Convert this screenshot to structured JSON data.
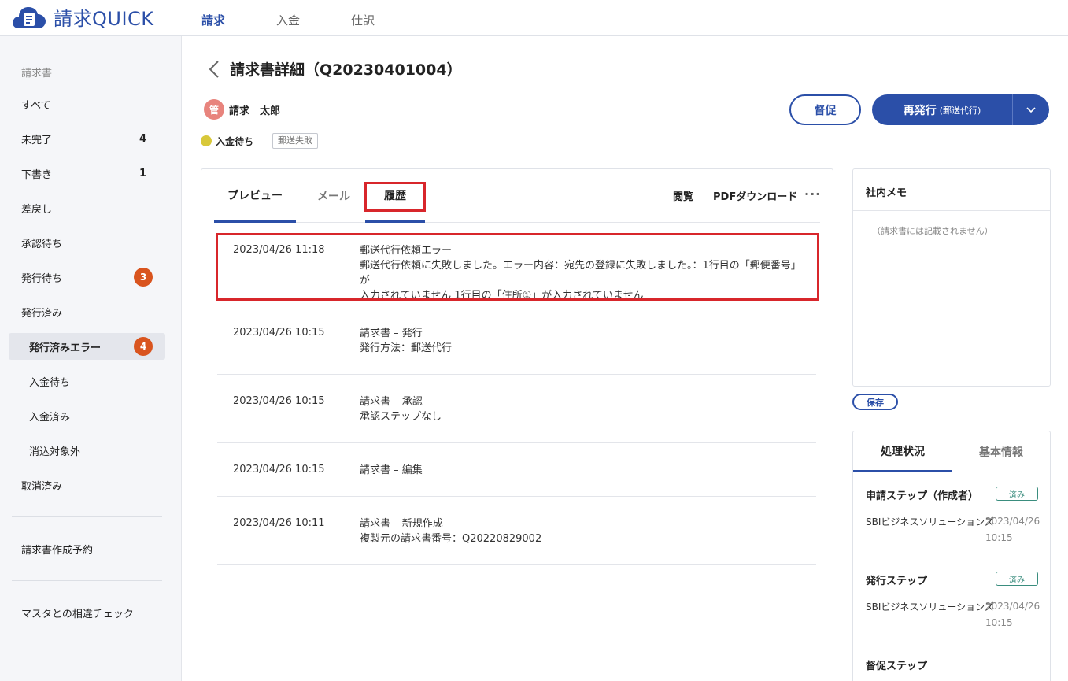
{
  "app": {
    "logo_text": "請求QUICK",
    "nav": [
      "請求",
      "入金",
      "仕訳"
    ]
  },
  "sidebar": {
    "heading": "請求書",
    "items": [
      {
        "label": "すべて"
      },
      {
        "label": "未完了",
        "count": "4"
      },
      {
        "label": "下書き",
        "count": "1"
      },
      {
        "label": "差戻し"
      },
      {
        "label": "承認待ち"
      },
      {
        "label": "発行待ち",
        "badge": "3"
      },
      {
        "label": "発行済み"
      },
      {
        "label": "発行済みエラー",
        "badge": "4"
      },
      {
        "label": "入金待ち"
      },
      {
        "label": "入金済み"
      },
      {
        "label": "消込対象外"
      },
      {
        "label": "取消済み"
      }
    ],
    "reservation": "請求書作成予約",
    "master_check": "マスタとの相違チェック"
  },
  "header": {
    "title": "請求書詳細（Q20230401004）",
    "avatar_char": "管",
    "user_name": "請求　太郎",
    "status": "入金待ち",
    "tag": "郵送失敗",
    "remind_button": "督促",
    "reissue_button": "再発行",
    "reissue_sub": "(郵送代行)",
    "colors": {
      "primary": "#2b4fa8",
      "highlight": "#d8262b",
      "badge": "#d9541e",
      "status_dot": "#d8c83a"
    }
  },
  "tabs": {
    "preview": "プレビュー",
    "mail": "メール",
    "history": "履歴",
    "view": "閲覧",
    "pdf": "PDFダウンロード",
    "more": "···"
  },
  "history": [
    {
      "time": "2023/04/26 11:18",
      "lines": [
        "郵送代行依頼エラー",
        "郵送代行依頼に失敗しました。エラー内容：宛先の登録に失敗しました。：1行目の「郵便番号」が",
        "入力されていません 1行目の「住所①」が入力されていません"
      ]
    },
    {
      "time": "2023/04/26 10:15",
      "lines": [
        "請求書 – 発行",
        "発行方法：郵送代行"
      ]
    },
    {
      "time": "2023/04/26 10:15",
      "lines": [
        "請求書 – 承認",
        "承認ステップなし"
      ]
    },
    {
      "time": "2023/04/26 10:15",
      "lines": [
        "請求書 – 編集"
      ]
    },
    {
      "time": "2023/04/26 10:11",
      "lines": [
        "請求書 – 新規作成",
        "複製元の請求書番号：Q20220829002"
      ]
    }
  ],
  "memo": {
    "title": "社内メモ",
    "placeholder": "（請求書には記載されません）",
    "save": "保存"
  },
  "status_panel": {
    "tab_status": "処理状況",
    "tab_basic": "基本情報",
    "steps": [
      {
        "title": "申請ステップ（作成者）",
        "done": "済み",
        "user": "SBIビジネスソリューションズ",
        "date": "2023/04/26 10:15"
      },
      {
        "title": "発行ステップ",
        "done": "済み",
        "user": "SBIビジネスソリューションズ",
        "date": "2023/04/26 10:15"
      },
      {
        "title": "督促ステップ"
      }
    ]
  }
}
